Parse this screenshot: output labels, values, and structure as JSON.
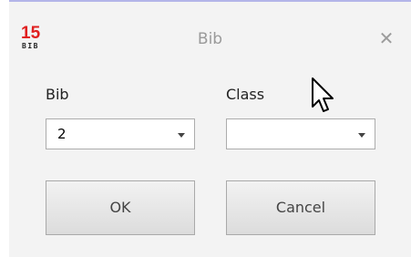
{
  "window": {
    "title": "Bib",
    "logo": {
      "number": "15",
      "text": "BIB"
    },
    "close_glyph": "✕"
  },
  "form": {
    "bib_label": "Bib",
    "class_label": "Class",
    "bib_value": "2",
    "class_value": ""
  },
  "buttons": {
    "ok_label": "OK",
    "cancel_label": "Cancel"
  },
  "icons": {
    "logo": "bib-logo-icon",
    "close": "close-icon",
    "dropdown": "chevron-down-icon",
    "cursor": "mouse-pointer-icon"
  },
  "colors": {
    "logo_red": "#e02020",
    "title_gray": "#9a9a9a",
    "dialog_bg": "#f3f3f3",
    "accent_border": "#b3b5e8"
  }
}
